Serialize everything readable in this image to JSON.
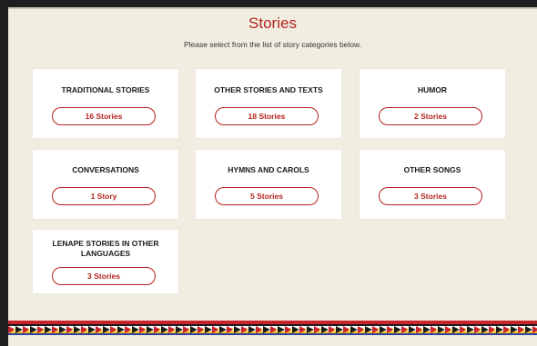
{
  "header": {
    "title": "Stories",
    "subtitle": "Please select from the list of story categories below."
  },
  "categories": [
    {
      "title": "TRADITIONAL STORIES",
      "count_label": "16 Stories"
    },
    {
      "title": "OTHER STORIES AND TEXTS",
      "count_label": "18 Stories"
    },
    {
      "title": "HUMOR",
      "count_label": "2 Stories"
    },
    {
      "title": "CONVERSATIONS",
      "count_label": "1 Story"
    },
    {
      "title": "HYMNS AND CAROLS",
      "count_label": "5 Stories"
    },
    {
      "title": "OTHER SONGS",
      "count_label": "3 Stories"
    },
    {
      "title": "LENAPE STORIES IN OTHER LANGUAGES",
      "count_label": "3 Stories"
    }
  ],
  "colors": {
    "accent": "#b5231d",
    "background": "#f1eee1",
    "card": "#ffffff",
    "pattern": [
      "#c8242d",
      "#1b1b1b",
      "#f5c21b",
      "#2e3fa6",
      "#ffffff"
    ]
  }
}
